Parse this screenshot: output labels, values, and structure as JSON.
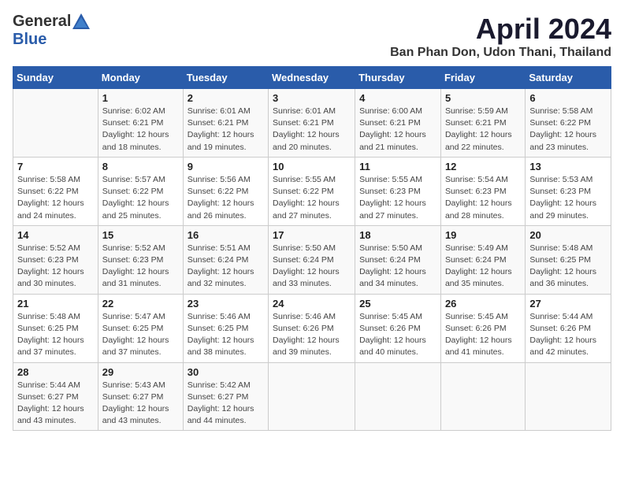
{
  "header": {
    "logo_general": "General",
    "logo_blue": "Blue",
    "title": "April 2024",
    "subtitle": "Ban Phan Don, Udon Thani, Thailand"
  },
  "days_of_week": [
    "Sunday",
    "Monday",
    "Tuesday",
    "Wednesday",
    "Thursday",
    "Friday",
    "Saturday"
  ],
  "weeks": [
    [
      {
        "day": "",
        "info": ""
      },
      {
        "day": "1",
        "info": "Sunrise: 6:02 AM\nSunset: 6:21 PM\nDaylight: 12 hours\nand 18 minutes."
      },
      {
        "day": "2",
        "info": "Sunrise: 6:01 AM\nSunset: 6:21 PM\nDaylight: 12 hours\nand 19 minutes."
      },
      {
        "day": "3",
        "info": "Sunrise: 6:01 AM\nSunset: 6:21 PM\nDaylight: 12 hours\nand 20 minutes."
      },
      {
        "day": "4",
        "info": "Sunrise: 6:00 AM\nSunset: 6:21 PM\nDaylight: 12 hours\nand 21 minutes."
      },
      {
        "day": "5",
        "info": "Sunrise: 5:59 AM\nSunset: 6:21 PM\nDaylight: 12 hours\nand 22 minutes."
      },
      {
        "day": "6",
        "info": "Sunrise: 5:58 AM\nSunset: 6:22 PM\nDaylight: 12 hours\nand 23 minutes."
      }
    ],
    [
      {
        "day": "7",
        "info": "Sunrise: 5:58 AM\nSunset: 6:22 PM\nDaylight: 12 hours\nand 24 minutes."
      },
      {
        "day": "8",
        "info": "Sunrise: 5:57 AM\nSunset: 6:22 PM\nDaylight: 12 hours\nand 25 minutes."
      },
      {
        "day": "9",
        "info": "Sunrise: 5:56 AM\nSunset: 6:22 PM\nDaylight: 12 hours\nand 26 minutes."
      },
      {
        "day": "10",
        "info": "Sunrise: 5:55 AM\nSunset: 6:22 PM\nDaylight: 12 hours\nand 27 minutes."
      },
      {
        "day": "11",
        "info": "Sunrise: 5:55 AM\nSunset: 6:23 PM\nDaylight: 12 hours\nand 27 minutes."
      },
      {
        "day": "12",
        "info": "Sunrise: 5:54 AM\nSunset: 6:23 PM\nDaylight: 12 hours\nand 28 minutes."
      },
      {
        "day": "13",
        "info": "Sunrise: 5:53 AM\nSunset: 6:23 PM\nDaylight: 12 hours\nand 29 minutes."
      }
    ],
    [
      {
        "day": "14",
        "info": "Sunrise: 5:52 AM\nSunset: 6:23 PM\nDaylight: 12 hours\nand 30 minutes."
      },
      {
        "day": "15",
        "info": "Sunrise: 5:52 AM\nSunset: 6:23 PM\nDaylight: 12 hours\nand 31 minutes."
      },
      {
        "day": "16",
        "info": "Sunrise: 5:51 AM\nSunset: 6:24 PM\nDaylight: 12 hours\nand 32 minutes."
      },
      {
        "day": "17",
        "info": "Sunrise: 5:50 AM\nSunset: 6:24 PM\nDaylight: 12 hours\nand 33 minutes."
      },
      {
        "day": "18",
        "info": "Sunrise: 5:50 AM\nSunset: 6:24 PM\nDaylight: 12 hours\nand 34 minutes."
      },
      {
        "day": "19",
        "info": "Sunrise: 5:49 AM\nSunset: 6:24 PM\nDaylight: 12 hours\nand 35 minutes."
      },
      {
        "day": "20",
        "info": "Sunrise: 5:48 AM\nSunset: 6:25 PM\nDaylight: 12 hours\nand 36 minutes."
      }
    ],
    [
      {
        "day": "21",
        "info": "Sunrise: 5:48 AM\nSunset: 6:25 PM\nDaylight: 12 hours\nand 37 minutes."
      },
      {
        "day": "22",
        "info": "Sunrise: 5:47 AM\nSunset: 6:25 PM\nDaylight: 12 hours\nand 37 minutes."
      },
      {
        "day": "23",
        "info": "Sunrise: 5:46 AM\nSunset: 6:25 PM\nDaylight: 12 hours\nand 38 minutes."
      },
      {
        "day": "24",
        "info": "Sunrise: 5:46 AM\nSunset: 6:26 PM\nDaylight: 12 hours\nand 39 minutes."
      },
      {
        "day": "25",
        "info": "Sunrise: 5:45 AM\nSunset: 6:26 PM\nDaylight: 12 hours\nand 40 minutes."
      },
      {
        "day": "26",
        "info": "Sunrise: 5:45 AM\nSunset: 6:26 PM\nDaylight: 12 hours\nand 41 minutes."
      },
      {
        "day": "27",
        "info": "Sunrise: 5:44 AM\nSunset: 6:26 PM\nDaylight: 12 hours\nand 42 minutes."
      }
    ],
    [
      {
        "day": "28",
        "info": "Sunrise: 5:44 AM\nSunset: 6:27 PM\nDaylight: 12 hours\nand 43 minutes."
      },
      {
        "day": "29",
        "info": "Sunrise: 5:43 AM\nSunset: 6:27 PM\nDaylight: 12 hours\nand 43 minutes."
      },
      {
        "day": "30",
        "info": "Sunrise: 5:42 AM\nSunset: 6:27 PM\nDaylight: 12 hours\nand 44 minutes."
      },
      {
        "day": "",
        "info": ""
      },
      {
        "day": "",
        "info": ""
      },
      {
        "day": "",
        "info": ""
      },
      {
        "day": "",
        "info": ""
      }
    ]
  ]
}
